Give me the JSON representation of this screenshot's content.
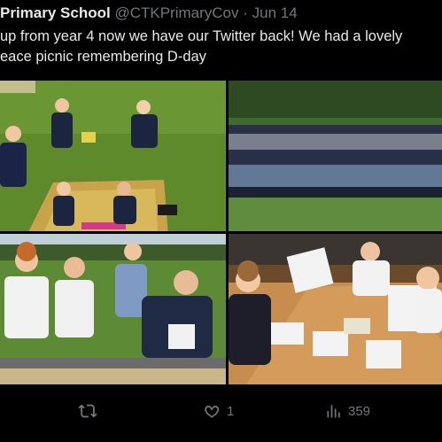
{
  "tweet": {
    "author_name": "Primary School",
    "handle": "@CTKPrimaryCov",
    "separator": "·",
    "date": "Jun 14",
    "text_lines": [
      "up from year 4 now we have our Twitter back! We had a lovely",
      "eace picnic remembering D-day"
    ]
  },
  "media": {
    "photos": [
      {
        "name": "photo-picnic-blanket-pupils"
      },
      {
        "name": "photo-class-group-on-field"
      },
      {
        "name": "photo-pupils-at-picnic-table"
      },
      {
        "name": "photo-classroom-activity"
      }
    ]
  },
  "actions": {
    "retweet_count": "",
    "like_count": "1",
    "views_count": "359"
  },
  "colors": {
    "background": "#000000",
    "primary_text": "#e7e9ea",
    "secondary_text": "#71767b"
  }
}
